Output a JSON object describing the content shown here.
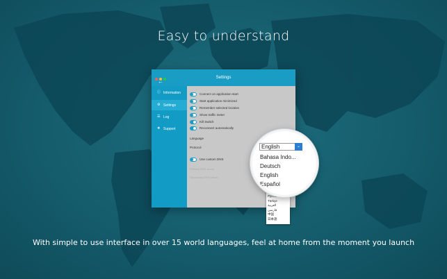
{
  "headline": "Easy to understand",
  "caption": "With simple to use interface in over 15 world languages, feel at home from the moment you launch",
  "window": {
    "title": "Settings",
    "traffic_lights": [
      "#ff5f57",
      "#febc2e",
      "#28c840"
    ],
    "sidebar": [
      {
        "label": "Information",
        "icon": "info-icon",
        "active": false
      },
      {
        "label": "Settings",
        "icon": "gear-icon",
        "active": true
      },
      {
        "label": "Log",
        "icon": "log-icon",
        "active": false
      },
      {
        "label": "Support",
        "icon": "support-icon",
        "active": false
      }
    ],
    "options": [
      {
        "label": "Connect on application start",
        "on": false
      },
      {
        "label": "Start application minimized",
        "on": false
      },
      {
        "label": "Remember selected location",
        "on": false
      },
      {
        "label": "Show traffic meter",
        "on": false
      },
      {
        "label": "Kill Switch",
        "on": true
      },
      {
        "label": "Reconnect automatically",
        "on": true
      }
    ],
    "language_label": "Language",
    "protocol_label": "Protocol",
    "custom_dns_label": "Use custom DNS",
    "custom_dns_on": false,
    "dns_field_1": "Primary DNS server",
    "dns_field_2": "Secondary DNS server"
  },
  "language_select": {
    "selected": "English",
    "dropdown_options": [
      "Bahasa Indo...",
      "Deutsch",
      "English",
      "Español"
    ],
    "more_options": [
      "Русский",
      "Türkçe",
      "العربية",
      "فارسی",
      "中国",
      "日本語"
    ]
  },
  "colors": {
    "accent": "#1a9dc4",
    "sidebar": "#129bc4",
    "background": "#155d6d"
  }
}
